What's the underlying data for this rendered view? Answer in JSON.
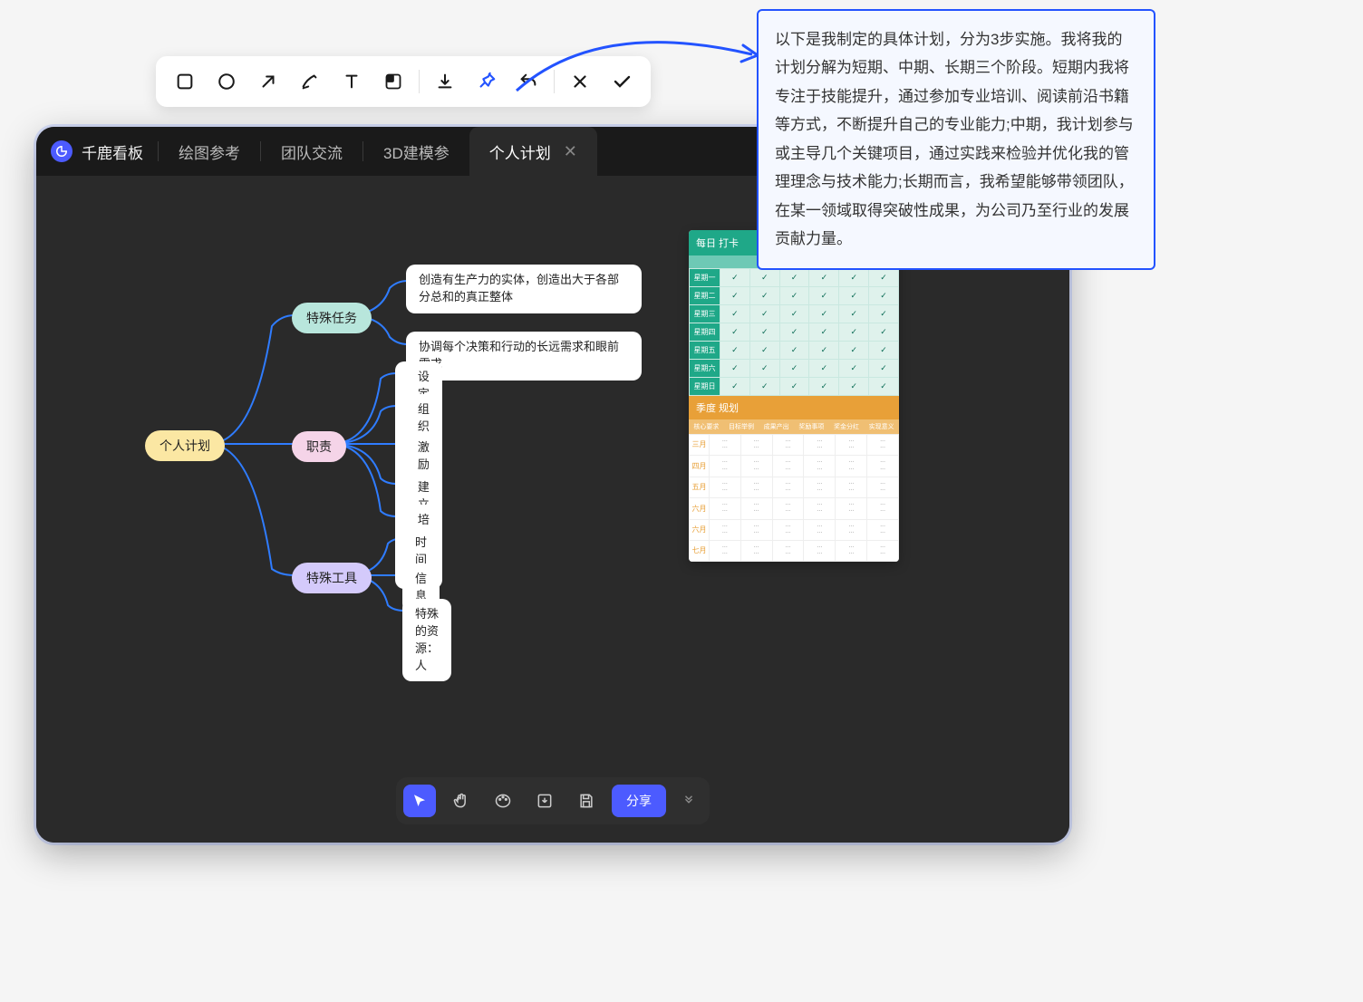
{
  "app": {
    "brand": "千鹿看板"
  },
  "tabs": {
    "items": [
      "绘图参考",
      "团队交流",
      "3D建模参",
      "个人计划"
    ],
    "activeIndex": 3
  },
  "tooltip": {
    "text": "以下是我制定的具体计划，分为3步实施。我将我的计划分解为短期、中期、长期三个阶段。短期内我将专注于技能提升，通过参加专业培训、阅读前沿书籍等方式，不断提升自己的专业能力;中期，我计划参与或主导几个关键项目，通过实践来检验并优化我的管理理念与技术能力;长期而言，我希望能够带领团队，在某一领域取得突破性成果，为公司乃至行业的发展贡献力量。"
  },
  "mindmap": {
    "root": "个人计划",
    "branches": {
      "b1": {
        "label": "特殊任务",
        "children": [
          "创造有生产力的实体，创造出大于各部分总和的真正整体",
          "协调每个决策和行动的长远需求和眼前需求"
        ]
      },
      "b2": {
        "label": "职责",
        "children": [
          "设定目标",
          "组织目标",
          "激励目标",
          "建立衡量目标",
          "培养目标"
        ]
      },
      "b3": {
        "label": "特殊工具",
        "children": [
          "时间",
          "信息",
          "特殊的资源：人"
        ]
      }
    }
  },
  "dailyCard": {
    "title": "每日 打卡",
    "days": [
      "星期一",
      "星期二",
      "星期三",
      "星期四",
      "星期五",
      "星期六",
      "星期日"
    ]
  },
  "quarterCard": {
    "title": "季度 规划",
    "columns": [
      "核心要求",
      "目标举例",
      "成果产出",
      "奖励事项",
      "奖金分红",
      "实现意义"
    ],
    "months": [
      "三月",
      "四月",
      "五月",
      "六月",
      "六月",
      "七月"
    ]
  },
  "bottomBar": {
    "share": "分享"
  },
  "toolbar": {
    "icons": [
      "square",
      "circle",
      "arrow",
      "pen",
      "text",
      "sticker",
      "download",
      "pin",
      "undo",
      "close",
      "check"
    ]
  }
}
